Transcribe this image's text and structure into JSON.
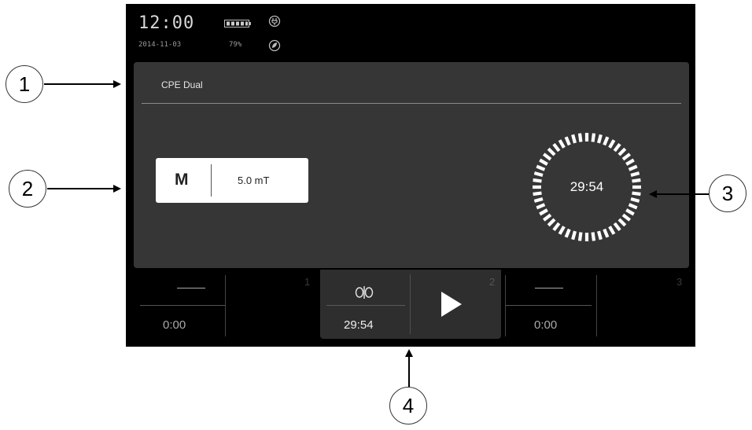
{
  "status": {
    "time": "12:00",
    "date": "2014-11-03",
    "battery_percent": "79%"
  },
  "program": {
    "title": "CPE Dual"
  },
  "intensity": {
    "mode": "M",
    "value": "5.0 mT"
  },
  "timer": {
    "remaining": "29:54"
  },
  "channels": [
    {
      "number": "1",
      "time": "0:00"
    },
    {
      "number": "2",
      "time": "29:54"
    },
    {
      "number": "3",
      "time": "0:00"
    }
  ],
  "callouts": [
    "1",
    "2",
    "3",
    "4"
  ],
  "colors": {
    "screen_bg": "#000000",
    "panel_bg": "#363636",
    "text_primary": "#ffffff"
  }
}
